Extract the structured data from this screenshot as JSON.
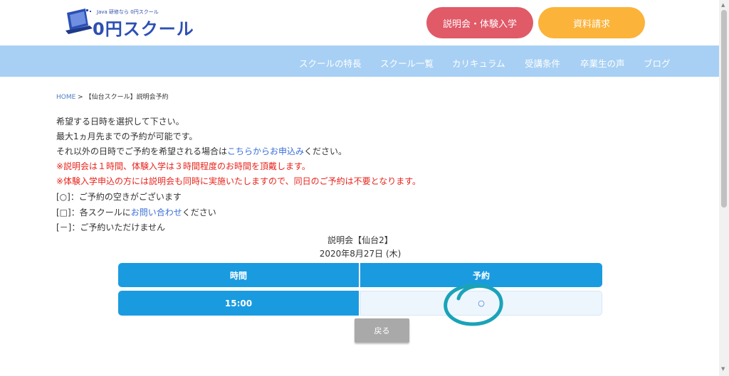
{
  "header": {
    "logo_tagline": "Java 研修なら 0円スクール",
    "logo_text": "0円スクール",
    "btn_setsumei": "説明会・体験入学",
    "btn_shiryo": "資料請求"
  },
  "nav": {
    "items": [
      "スクールの特長",
      "スクール一覧",
      "カリキュラム",
      "受講条件",
      "卒業生の声",
      "ブログ"
    ]
  },
  "breadcrumb": {
    "home": "HOME",
    "separator": " > ",
    "current": "【仙台スクール】説明会予約"
  },
  "content": {
    "line1": "希望する日時を選択して下さい。",
    "line2": "最大1ヵ月先までの予約が可能です。",
    "line3_pre": "それ以外の日時でご予約を希望される場合は",
    "line3_link": "こちらからお申込み",
    "line3_post": "ください。",
    "red1": "※説明会は１時間、体験入学は３時間程度のお時間を頂戴します。",
    "red2": "※体験入学申込の方には説明会も同時に実施いたしますので、同日のご予約は不要となります。",
    "legend1": "[○]：ご予約の空きがございます",
    "legend2_pre": "[□]：各スクールに",
    "legend2_link": "お問い合わせ",
    "legend2_post": "ください",
    "legend3": "[－]：ご予約いただけません"
  },
  "schedule": {
    "title": "説明会【仙台2】",
    "date": "2020年8月27日 (木)",
    "col_time": "時間",
    "col_reserve": "予約",
    "rows": [
      {
        "time": "15:00",
        "status": "○"
      }
    ]
  },
  "back_button": "戻る",
  "colors": {
    "nav_bg": "#a8d0f4",
    "table_header": "#1a9be0",
    "btn_setsumei": "#e05a68",
    "btn_shiryo": "#fbb33a",
    "annotation": "#1aa3b8"
  }
}
